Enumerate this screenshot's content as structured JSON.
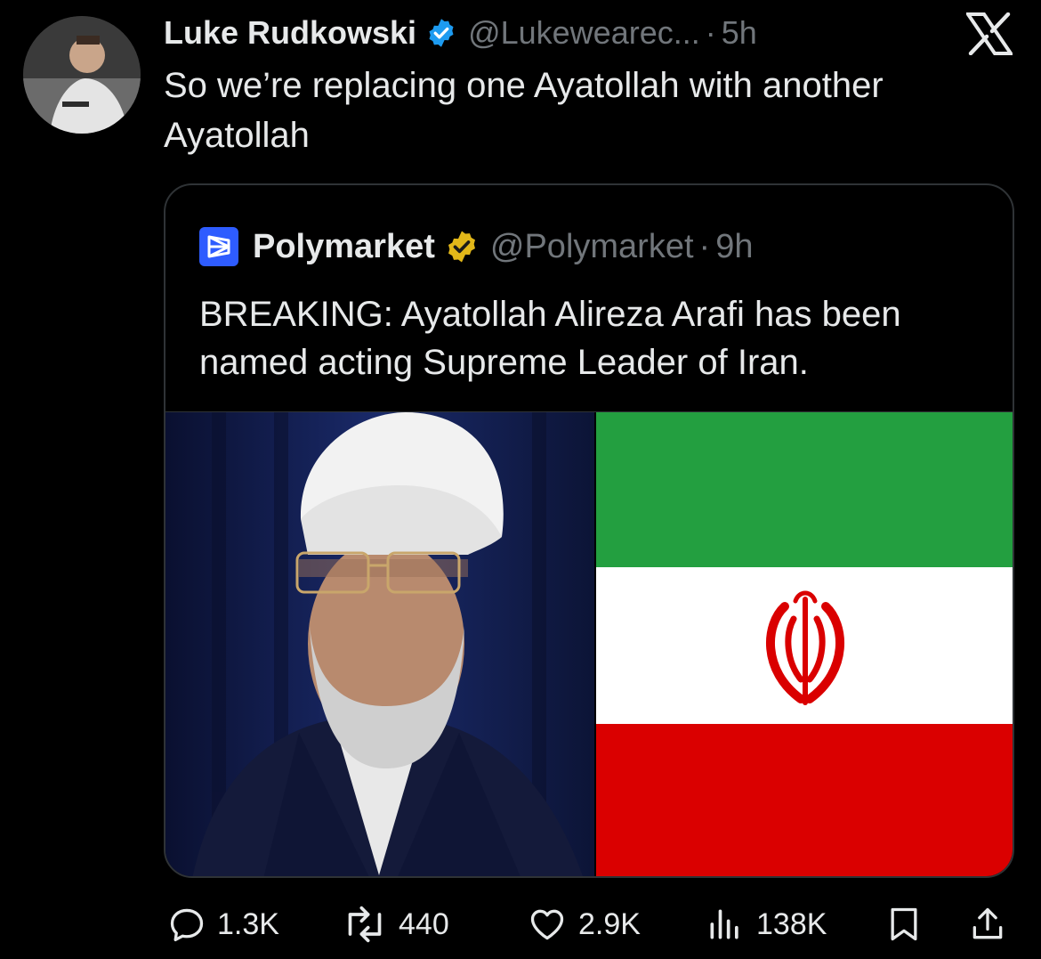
{
  "author": {
    "display_name": "Luke Rudkowski",
    "handle": "@Lukewearec...",
    "separator": "·",
    "time": "5h",
    "verified_color": "#1d9bf0"
  },
  "tweet_text": "So we’re replacing one Ayatollah with another Ayatollah",
  "quoted": {
    "display_name": "Polymarket",
    "handle": "@Polymarket",
    "separator": "·",
    "time": "9h",
    "badge_color": "#e2b719",
    "brand_color": "#2e5cff",
    "text": "BREAKING: Ayatollah Alireza Arafi has been named acting Supreme Leader of Iran."
  },
  "media": {
    "photo_icon": "portrait-photo",
    "flag_icon": "iran-flag",
    "flag_colors": {
      "green": "#239f40",
      "white": "#ffffff",
      "red": "#da0000"
    }
  },
  "actions": {
    "replies": "1.3K",
    "reposts": "440",
    "likes": "2.9K",
    "views": "138K"
  },
  "icons": [
    "x-logo-icon",
    "verified-icon",
    "reply-icon",
    "repost-icon",
    "like-icon",
    "views-icon",
    "bookmark-icon",
    "share-icon"
  ]
}
